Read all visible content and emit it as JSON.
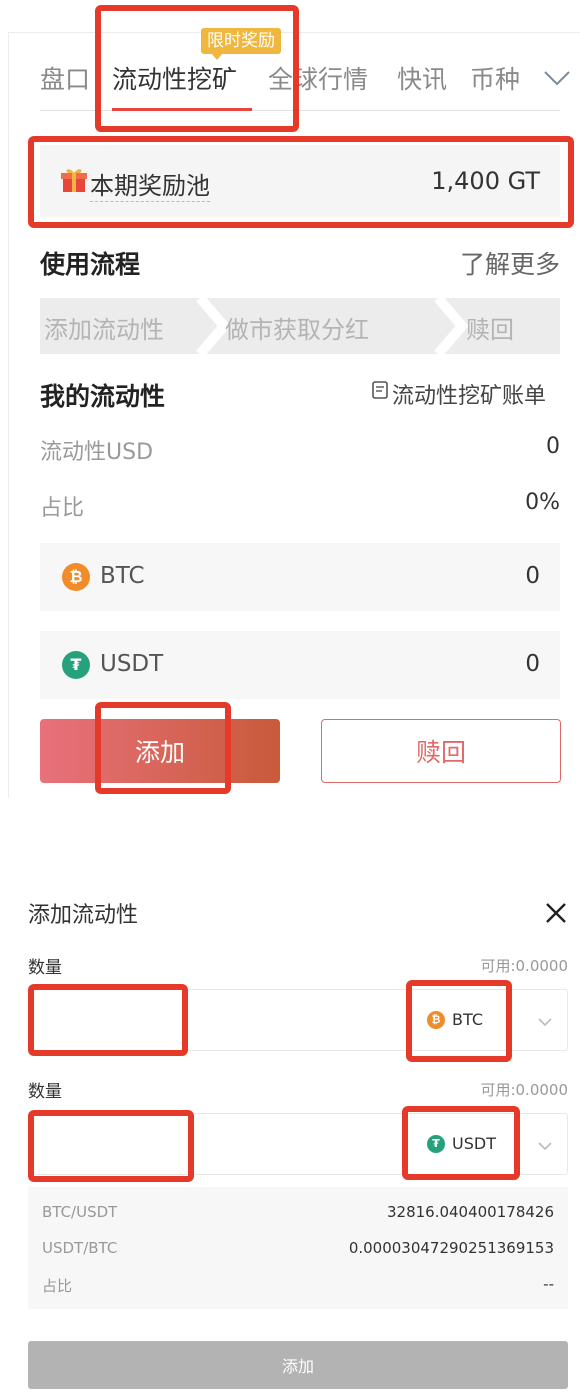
{
  "tabs": [
    {
      "label": "盘口"
    },
    {
      "label": "流动性挖矿"
    },
    {
      "label": "全球行情"
    },
    {
      "label": "快讯"
    },
    {
      "label": "币种"
    }
  ],
  "tab_badge": "限时奖励",
  "reward_pool": {
    "label": "本期奖励池",
    "value": "1,400 GT"
  },
  "process": {
    "title": "使用流程",
    "link": "了解更多",
    "steps": [
      "添加流动性",
      "做市获取分红",
      "赎回"
    ]
  },
  "my_liquidity": {
    "title": "我的流动性",
    "bill_link": "流动性挖矿账单",
    "usd_label": "流动性USD",
    "usd_value": "0",
    "share_label": "占比",
    "share_value": "0%",
    "coins": [
      {
        "name": "BTC",
        "value": "0",
        "color": "#f08c2a"
      },
      {
        "name": "USDT",
        "value": "0",
        "color": "#26a17b"
      }
    ]
  },
  "buttons": {
    "add": "添加",
    "redeem": "赎回"
  },
  "modal": {
    "title": "添加流动性",
    "field1": {
      "label": "数量",
      "available": "可用:0.0000",
      "token": "BTC"
    },
    "field2": {
      "label": "数量",
      "available": "可用:0.0000",
      "token": "USDT"
    },
    "info": [
      {
        "label": "BTC/USDT",
        "value": "32816.040400178426"
      },
      {
        "label": "USDT/BTC",
        "value": "0.00003047290251369153"
      },
      {
        "label": "占比",
        "value": "--"
      }
    ],
    "submit": "添加"
  },
  "colors": {
    "accent": "#e8463a",
    "highlight": "#e53a2a",
    "badge": "#f0b740",
    "btc": "#f08c2a",
    "usdt": "#26a17b"
  }
}
